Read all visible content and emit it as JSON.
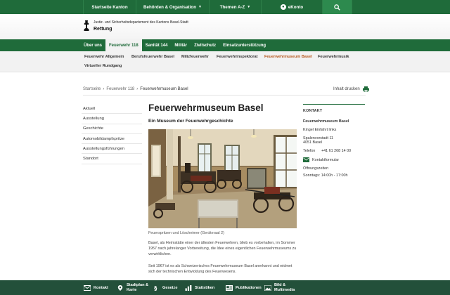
{
  "topbar": {
    "items": [
      {
        "label": "Startseite Kanton"
      },
      {
        "label": "Behörden & Organisation"
      },
      {
        "label": "Themen A-Z"
      },
      {
        "label": "eKonto"
      }
    ]
  },
  "header": {
    "department": "Justiz- und Sicherheitsdepartement des Kantons Basel-Stadt",
    "section": "Rettung"
  },
  "mainnav": {
    "items": [
      {
        "label": "Über uns"
      },
      {
        "label": "Feuerwehr 118"
      },
      {
        "label": "Sanität 144"
      },
      {
        "label": "Militär"
      },
      {
        "label": "Zivilschutz"
      },
      {
        "label": "Einsatzunterstützung"
      }
    ]
  },
  "subnav": {
    "items": [
      {
        "label": "Feuerwehr Allgemein"
      },
      {
        "label": "Berufsfeuerwehr Basel"
      },
      {
        "label": "Milizfeuerwehr"
      },
      {
        "label": "Feuerwehrinspektorat"
      },
      {
        "label": "Feuerwehrmuseum Basel"
      },
      {
        "label": "Feuerwehrmusik"
      },
      {
        "label": "Virtueller Rundgang"
      }
    ]
  },
  "breadcrumb": {
    "items": [
      "Startseite",
      "Feuerwehr 118",
      "Feuerwehrmuseum Basel"
    ],
    "separator": "›"
  },
  "print": {
    "label": "Inhalt drucken"
  },
  "leftnav": {
    "items": [
      {
        "label": "Aktuell"
      },
      {
        "label": "Ausstellung"
      },
      {
        "label": "Geschichte"
      },
      {
        "label": "Automobildampfspritze"
      },
      {
        "label": "Ausstellungsführungen"
      },
      {
        "label": "Standort"
      }
    ]
  },
  "article": {
    "title": "Feuerwehrmuseum Basel",
    "lead": "Ein Museum der Feuerwehrgeschichte",
    "caption": "Feuerspritzen und Löscheimer (Geräteraal 2)",
    "paragraph1": "Basel, als Heimstätte einer der ältesten Feuerwehren, blieb es vorbehalten, im Sommer 1957 nach jahrelanger Vorbereitung, die Idee eines eigentlichen Feuerwehrmuseums zu verwirklichen.",
    "paragraph2": "Seit 1967 ist es als Schweizerisches Feuerwehrmuseum Basel anerkannt und widmet sich der technischen Entwicklung des Feuerwesens."
  },
  "contact": {
    "heading": "KONTAKT",
    "name": "Feuerwehrmuseum Basel",
    "entrance": "Kingel Einfahrt links",
    "street": "Spalenvorstadt 11",
    "city": "4051 Basel",
    "phone_label": "Telefon",
    "phone": "+41 61 268 14 00",
    "form_label": "Kontaktformular",
    "hours_label": "Öffnungszeiten",
    "hours": "Sonntags: 14:00h - 17:00h"
  },
  "footer": {
    "items": [
      {
        "label": "Kontakt"
      },
      {
        "label1": "Stadtplan &",
        "label2": "Karte"
      },
      {
        "label": "Gesetze"
      },
      {
        "label": "Statistiken"
      },
      {
        "label": "Publikationen"
      },
      {
        "label1": "Bild &",
        "label2": "Multimedia"
      }
    ]
  },
  "colors": {
    "primary_green": "#1f6b3a",
    "footer_green": "#23503a",
    "active_orange": "#b5571d"
  }
}
